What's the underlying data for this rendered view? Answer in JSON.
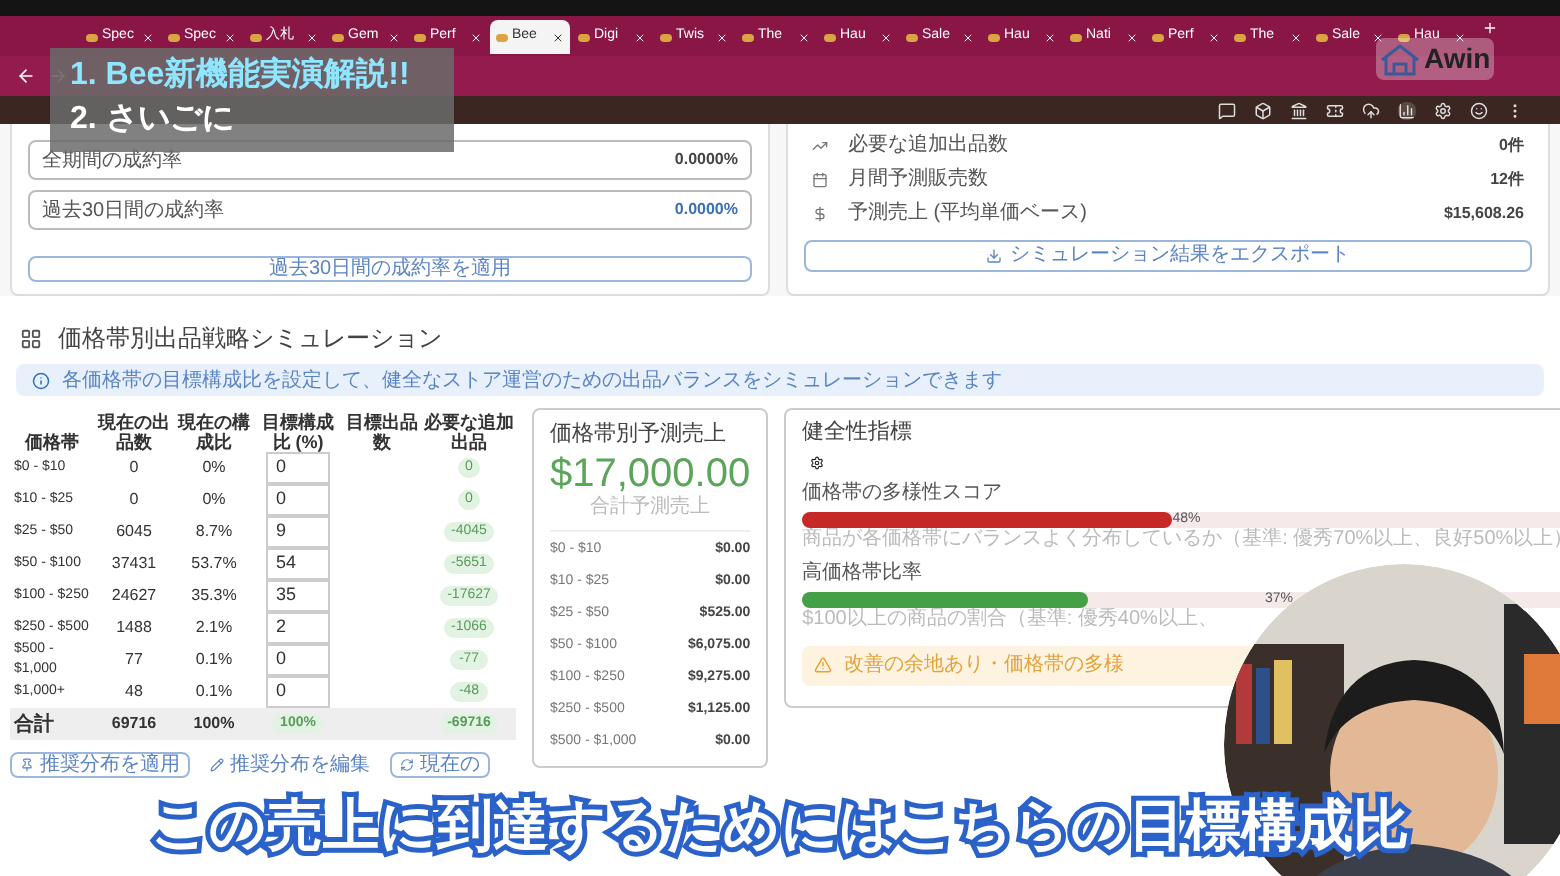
{
  "tabs": [
    {
      "label": "Spec",
      "selected": false
    },
    {
      "label": "Spec",
      "selected": false
    },
    {
      "label": "入札",
      "selected": false
    },
    {
      "label": "Gem",
      "selected": false
    },
    {
      "label": "Perf",
      "selected": false
    },
    {
      "label": "Bee",
      "selected": true
    },
    {
      "label": "Digi",
      "selected": false
    },
    {
      "label": "Twis",
      "selected": false
    },
    {
      "label": "The",
      "selected": false
    },
    {
      "label": "Hau",
      "selected": false
    },
    {
      "label": "Sale",
      "selected": false
    },
    {
      "label": "Hau",
      "selected": false
    },
    {
      "label": "Nati",
      "selected": false
    },
    {
      "label": "Perf",
      "selected": false
    },
    {
      "label": "The",
      "selected": false
    },
    {
      "label": "Sale",
      "selected": false
    },
    {
      "label": "Hau",
      "selected": false
    }
  ],
  "overlay": {
    "lines": [
      "1. Bee新機能実演解説!!",
      "2. さいごに"
    ]
  },
  "logo": {
    "text": "Awin"
  },
  "conversion": {
    "rows": [
      {
        "label": "全期間の成約率",
        "value": "0.0000%",
        "highlight": false
      },
      {
        "label": "過去30日間の成約率",
        "value": "0.0000%",
        "highlight": true
      }
    ],
    "button": "過去30日間の成約率を適用"
  },
  "summary": {
    "rows": [
      {
        "kind": "chart",
        "label": "必要な追加出品数",
        "value": "0件"
      },
      {
        "kind": "calendar",
        "label": "月間予測販売数",
        "value": "12件"
      },
      {
        "kind": "dollar",
        "label": "予測売上 (平均単価ベース)",
        "value": "$15,608.26"
      }
    ],
    "button": "シミュレーション結果をエクスポート"
  },
  "simulation": {
    "title": "価格帯別出品戦略シミュレーション",
    "info": "各価格帯の目標構成比を設定して、健全なストア運営のための出品バランスをシミュレーションできます",
    "table": {
      "columns": [
        "価格帯",
        "現在の出品数",
        "現在の構成比",
        "目標構成比 (%)",
        "目標出品数",
        "必要な追加出品"
      ],
      "rows": [
        {
          "cells": [
            "$0 - $10",
            "0",
            "0%"
          ],
          "target": "0",
          "needed": "0"
        },
        {
          "cells": [
            "$10 - $25",
            "0",
            "0%"
          ],
          "target": "0",
          "needed": "0"
        },
        {
          "cells": [
            "$25 - $50",
            "6045",
            "8.7%"
          ],
          "target": "9",
          "needed": "-4045"
        },
        {
          "cells": [
            "$50 - $100",
            "37431",
            "53.7%"
          ],
          "target": "54",
          "needed": "-5651"
        },
        {
          "cells": [
            "$100 - $250",
            "24627",
            "35.3%"
          ],
          "target": "35",
          "needed": "-17627"
        },
        {
          "cells": [
            "$250 - $500",
            "1488",
            "2.1%"
          ],
          "target": "2",
          "needed": "-1066"
        },
        {
          "cells": [
            "$500 - $1,000",
            "77",
            "0.1%"
          ],
          "target": "0",
          "needed": "-77"
        },
        {
          "cells": [
            "$1,000+",
            "48",
            "0.1%"
          ],
          "target": "0",
          "needed": "-48"
        }
      ],
      "total": {
        "cells": [
          "合計",
          "69716",
          "100%"
        ],
        "target": "100%",
        "needed": "-69716"
      }
    },
    "buttons": [
      {
        "kind": "pin",
        "label": "推奨分布を適用"
      },
      {
        "kind": "pencil",
        "label": "推奨分布を編集"
      },
      {
        "kind": "refresh",
        "label": "現在の"
      }
    ]
  },
  "forecast": {
    "title": "価格帯別予測売上",
    "total": "$17,000.00",
    "caption": "合計予測売上",
    "rows": [
      {
        "label": "$0 - $10",
        "value": "$0.00"
      },
      {
        "label": "$10 - $25",
        "value": "$0.00"
      },
      {
        "label": "$25 - $50",
        "value": "$525.00"
      },
      {
        "label": "$50 - $100",
        "value": "$6,075.00"
      },
      {
        "label": "$100 - $250",
        "value": "$9,275.00"
      },
      {
        "label": "$250 - $500",
        "value": "$1,125.00"
      },
      {
        "label": "$500 - $1,000",
        "value": "$0.00"
      }
    ]
  },
  "health": {
    "title": "健全性指標",
    "metrics": [
      {
        "label": "価格帯の多様性スコア",
        "level": 0.48,
        "reading": "48%",
        "color": "#c62828",
        "note": "商品が各価格帯にバランスよく分布しているか（基準: 優秀70%以上、良好50%以上）"
      },
      {
        "label": "高価格帯比率",
        "level": 0.37,
        "reading": "37%",
        "color": "#43a047",
        "note": "$100以上の商品の割合（基準: 優秀40%以上、"
      }
    ],
    "warning": "改善の余地あり・価格帯の多様"
  },
  "subtitle": "この売上に到達するためにはこちらの目標構成比"
}
